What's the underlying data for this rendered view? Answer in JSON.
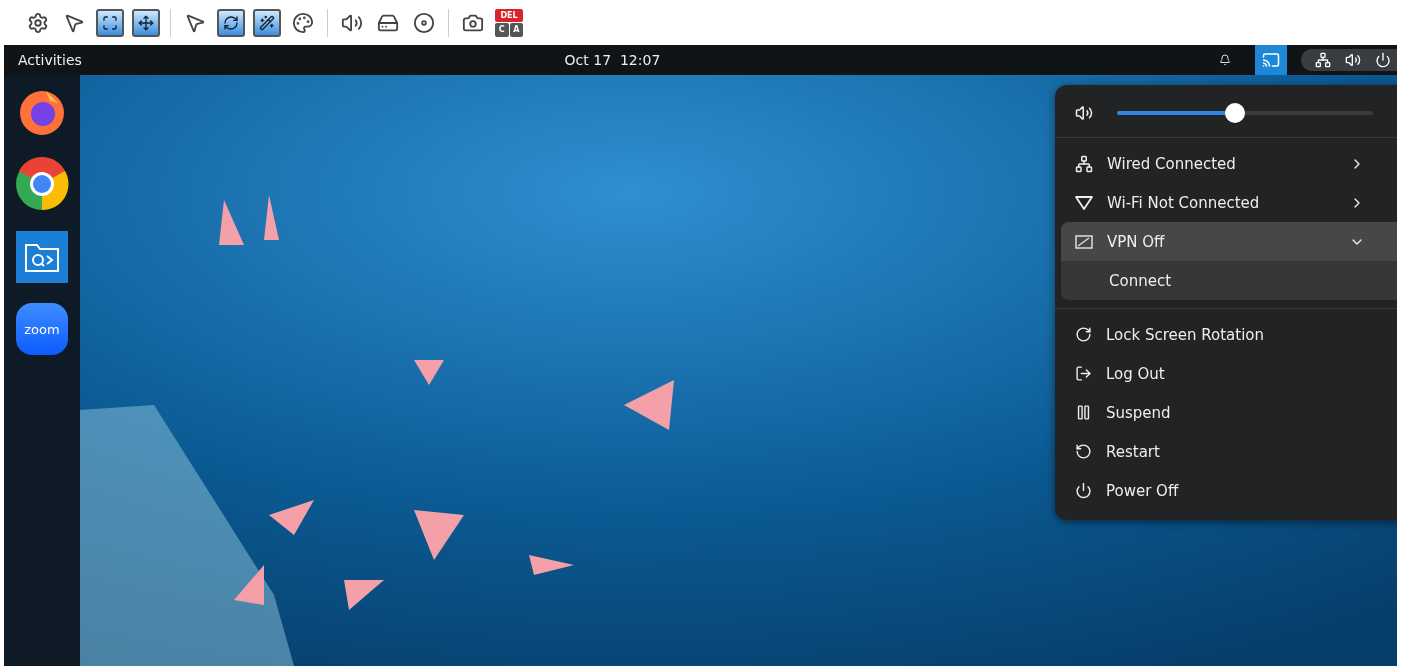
{
  "toolbar": {
    "groups": [
      [
        {
          "kind": "settings"
        },
        {
          "kind": "pointer"
        },
        {
          "kind": "fullscreen"
        },
        {
          "kind": "fit"
        }
      ],
      [
        {
          "kind": "cursor"
        },
        {
          "kind": "refresh"
        },
        {
          "kind": "magic"
        },
        {
          "kind": "color"
        }
      ],
      [
        {
          "kind": "sound"
        },
        {
          "kind": "drive"
        },
        {
          "kind": "disc"
        }
      ],
      [
        {
          "kind": "camera"
        },
        {
          "kind": "keys",
          "labels": [
            "DEL",
            "C",
            "A"
          ]
        }
      ]
    ]
  },
  "top_bar": {
    "activities": "Activities",
    "clock": "Oct 17  12:07",
    "indicators": [
      {
        "kind": "bell",
        "selected": false
      },
      {
        "kind": "cast",
        "selected": true
      }
    ],
    "status": [
      {
        "kind": "network"
      },
      {
        "kind": "volume"
      },
      {
        "kind": "power"
      }
    ]
  },
  "dock": {
    "apps": [
      {
        "kind": "firefox"
      },
      {
        "kind": "chrome"
      },
      {
        "kind": "files"
      },
      {
        "kind": "zoom",
        "label": "zoom"
      }
    ]
  },
  "menu": {
    "volume": {
      "level": 0.46
    },
    "network": [
      {
        "kind": "wired",
        "label": "Wired Connected",
        "expanded": false
      },
      {
        "kind": "wifi",
        "label": "Wi-Fi Not Connected",
        "expanded": false
      },
      {
        "kind": "vpn",
        "label": "VPN Off",
        "expanded": true,
        "children": [
          {
            "label": "Connect"
          }
        ]
      }
    ],
    "actions": [
      {
        "kind": "rotation",
        "label": "Lock Screen Rotation"
      },
      {
        "kind": "logout",
        "label": "Log Out"
      },
      {
        "kind": "suspend",
        "label": "Suspend"
      },
      {
        "kind": "restart",
        "label": "Restart"
      },
      {
        "kind": "power",
        "label": "Power Off"
      }
    ]
  }
}
